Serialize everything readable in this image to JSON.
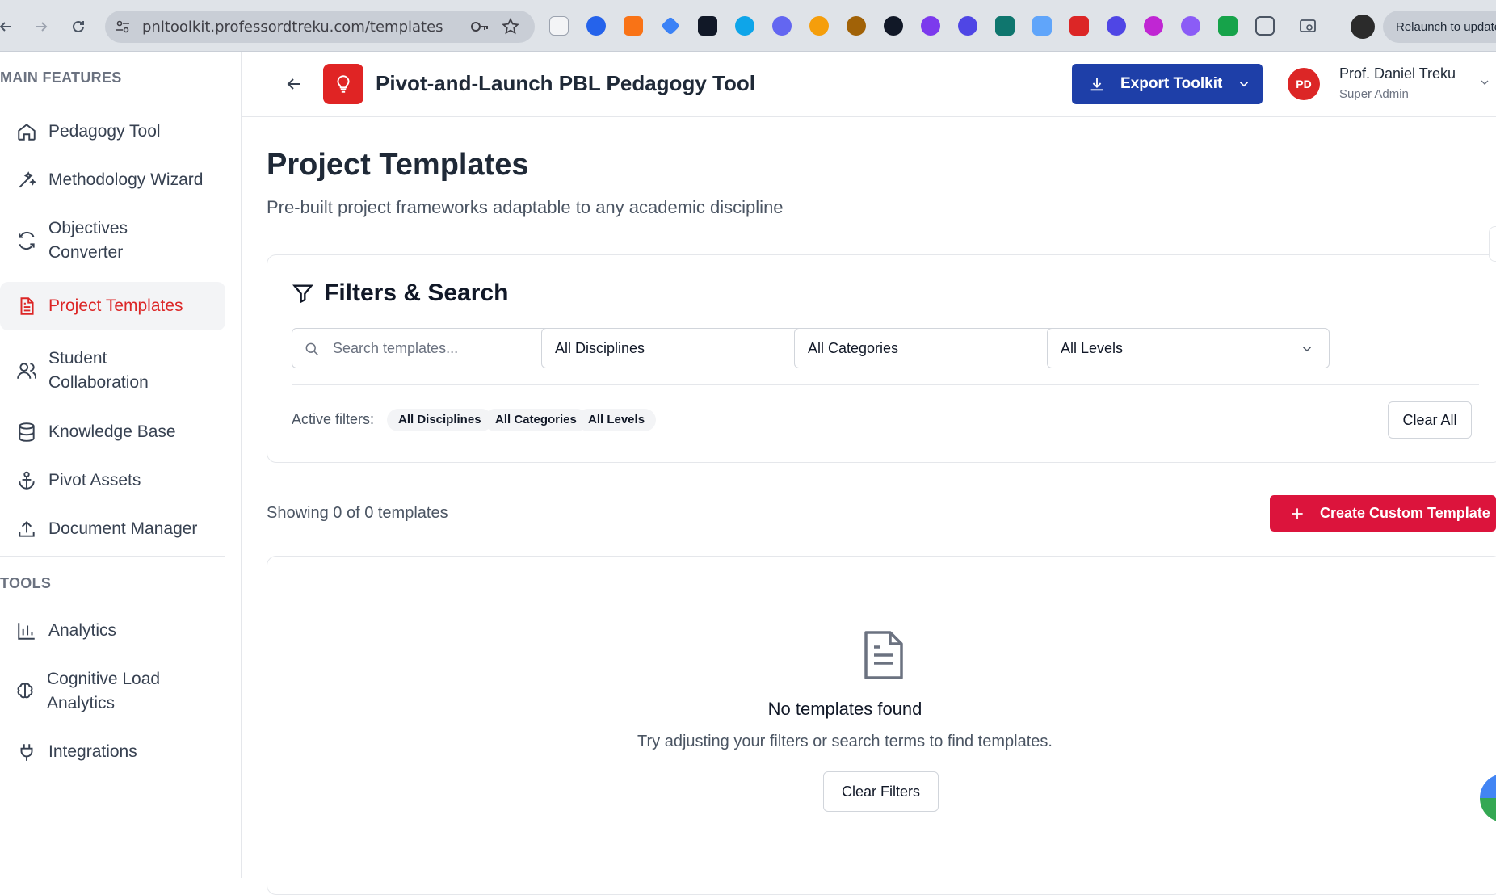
{
  "browser": {
    "url": "pnltoolkit.professordtreku.com/templates",
    "relaunch_label": "Relaunch to update"
  },
  "sidebar": {
    "main_heading": "MAIN FEATURES",
    "tools_heading": "TOOLS",
    "items": [
      {
        "label": "Pedagogy Tool",
        "icon": "home-icon"
      },
      {
        "label": "Methodology Wizard",
        "icon": "wand-icon"
      },
      {
        "label": "Objectives Converter",
        "icon": "refresh-icon"
      },
      {
        "label": "Project Templates",
        "icon": "file-text-icon",
        "active": true
      },
      {
        "label": "Student Collaboration",
        "icon": "users-icon"
      },
      {
        "label": "Knowledge Base",
        "icon": "database-icon"
      },
      {
        "label": "Pivot Assets",
        "icon": "anchor-icon"
      },
      {
        "label": "Document Manager",
        "icon": "upload-icon"
      }
    ],
    "tools": [
      {
        "label": "Analytics",
        "icon": "bar-chart-icon"
      },
      {
        "label": "Cognitive Load Analytics",
        "icon": "brain-icon"
      },
      {
        "label": "Integrations",
        "icon": "plug-icon"
      }
    ]
  },
  "header": {
    "title": "Pivot-and-Launch PBL Pedagogy Tool",
    "export_label": "Export Toolkit",
    "avatar_initials": "PD",
    "user_name": "Prof. Daniel Treku",
    "user_role": "Super Admin"
  },
  "main": {
    "title": "Project Templates",
    "subtitle": "Pre-built project frameworks adaptable to any academic discipline",
    "filters": {
      "title": "Filters & Search",
      "search_placeholder": "Search templates...",
      "discipline_value": "All Disciplines",
      "category_value": "All Categories",
      "level_value": "All Levels",
      "active_label": "Active filters:",
      "chips": [
        "All Disciplines",
        "All Categories",
        "All Levels"
      ],
      "clear_all_label": "Clear All"
    },
    "showing_text": "Showing 0 of 0 templates",
    "create_label": "Create Custom Template",
    "empty": {
      "title": "No templates found",
      "text": "Try adjusting your filters or search terms to find templates.",
      "button": "Clear Filters"
    }
  },
  "colors": {
    "brand_red": "#dc143c",
    "primary_blue": "#1e3fa8",
    "active_text": "#dc2626"
  }
}
